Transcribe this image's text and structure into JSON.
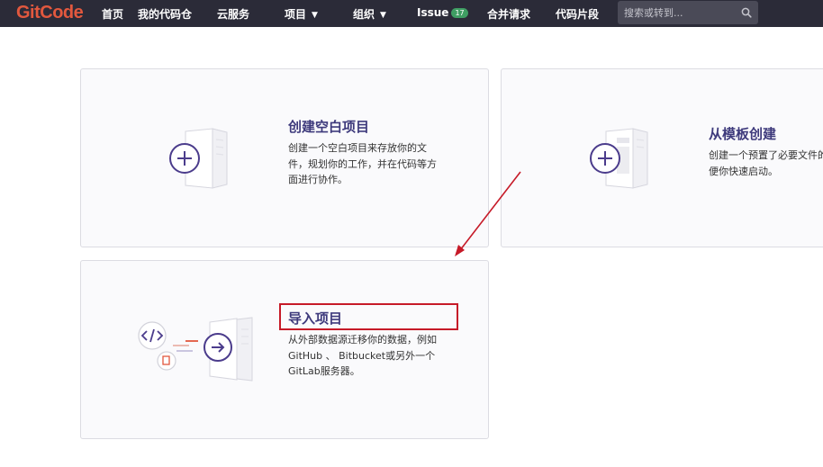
{
  "brand": {
    "logo_text": "GitCode"
  },
  "nav": {
    "home": "首页",
    "my_repos": "我的代码仓",
    "cloud": "云服务",
    "projects": "项目",
    "orgs": "组织",
    "issue": "Issue",
    "issue_count": "17",
    "merge_requests": "合并请求",
    "snippets": "代码片段"
  },
  "search": {
    "placeholder": "搜索或转到..."
  },
  "cards": {
    "blank": {
      "title": "创建空白项目",
      "desc_lines": [
        "创建一个空白项目来存放你的文",
        "件，规划你的工作，并在代码等方",
        "面进行协作。"
      ]
    },
    "template": {
      "title": "从模板创建",
      "desc_lines": [
        "创建一个预置了必要文件的项目，",
        "便你快速启动。"
      ]
    },
    "import": {
      "title": "导入项目",
      "desc_lines": [
        "从外部数据源迁移你的数据，例如",
        "GitHub 、 Bitbucket或另外一个",
        "GitLab服务器。"
      ]
    }
  },
  "colors": {
    "topbar": "#2b2b38",
    "logo": "#e2583e",
    "accent_purple": "#4b3c8c",
    "badge_green": "#3f9e63",
    "annotation_red": "#c61a28"
  },
  "icons": [
    "search-icon",
    "chevron-down-icon",
    "plus-icon",
    "code-icon",
    "arrow-right-icon",
    "document-icon"
  ]
}
